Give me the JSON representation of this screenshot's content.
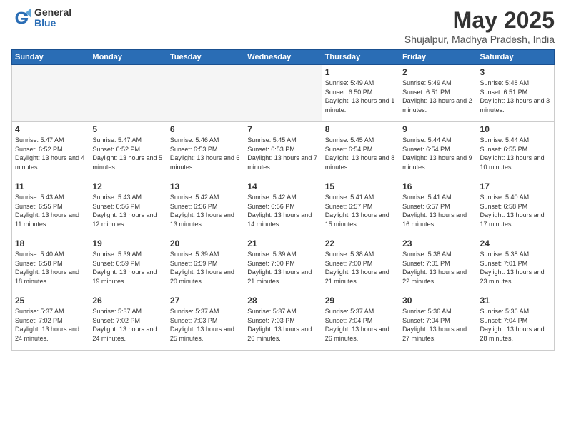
{
  "logo": {
    "general": "General",
    "blue": "Blue"
  },
  "title": "May 2025",
  "location": "Shujalpur, Madhya Pradesh, India",
  "days_of_week": [
    "Sunday",
    "Monday",
    "Tuesday",
    "Wednesday",
    "Thursday",
    "Friday",
    "Saturday"
  ],
  "weeks": [
    [
      {
        "day": "",
        "info": ""
      },
      {
        "day": "",
        "info": ""
      },
      {
        "day": "",
        "info": ""
      },
      {
        "day": "",
        "info": ""
      },
      {
        "day": "1",
        "info": "Sunrise: 5:49 AM\nSunset: 6:50 PM\nDaylight: 13 hours and 1 minute."
      },
      {
        "day": "2",
        "info": "Sunrise: 5:49 AM\nSunset: 6:51 PM\nDaylight: 13 hours and 2 minutes."
      },
      {
        "day": "3",
        "info": "Sunrise: 5:48 AM\nSunset: 6:51 PM\nDaylight: 13 hours and 3 minutes."
      }
    ],
    [
      {
        "day": "4",
        "info": "Sunrise: 5:47 AM\nSunset: 6:52 PM\nDaylight: 13 hours and 4 minutes."
      },
      {
        "day": "5",
        "info": "Sunrise: 5:47 AM\nSunset: 6:52 PM\nDaylight: 13 hours and 5 minutes."
      },
      {
        "day": "6",
        "info": "Sunrise: 5:46 AM\nSunset: 6:53 PM\nDaylight: 13 hours and 6 minutes."
      },
      {
        "day": "7",
        "info": "Sunrise: 5:45 AM\nSunset: 6:53 PM\nDaylight: 13 hours and 7 minutes."
      },
      {
        "day": "8",
        "info": "Sunrise: 5:45 AM\nSunset: 6:54 PM\nDaylight: 13 hours and 8 minutes."
      },
      {
        "day": "9",
        "info": "Sunrise: 5:44 AM\nSunset: 6:54 PM\nDaylight: 13 hours and 9 minutes."
      },
      {
        "day": "10",
        "info": "Sunrise: 5:44 AM\nSunset: 6:55 PM\nDaylight: 13 hours and 10 minutes."
      }
    ],
    [
      {
        "day": "11",
        "info": "Sunrise: 5:43 AM\nSunset: 6:55 PM\nDaylight: 13 hours and 11 minutes."
      },
      {
        "day": "12",
        "info": "Sunrise: 5:43 AM\nSunset: 6:56 PM\nDaylight: 13 hours and 12 minutes."
      },
      {
        "day": "13",
        "info": "Sunrise: 5:42 AM\nSunset: 6:56 PM\nDaylight: 13 hours and 13 minutes."
      },
      {
        "day": "14",
        "info": "Sunrise: 5:42 AM\nSunset: 6:56 PM\nDaylight: 13 hours and 14 minutes."
      },
      {
        "day": "15",
        "info": "Sunrise: 5:41 AM\nSunset: 6:57 PM\nDaylight: 13 hours and 15 minutes."
      },
      {
        "day": "16",
        "info": "Sunrise: 5:41 AM\nSunset: 6:57 PM\nDaylight: 13 hours and 16 minutes."
      },
      {
        "day": "17",
        "info": "Sunrise: 5:40 AM\nSunset: 6:58 PM\nDaylight: 13 hours and 17 minutes."
      }
    ],
    [
      {
        "day": "18",
        "info": "Sunrise: 5:40 AM\nSunset: 6:58 PM\nDaylight: 13 hours and 18 minutes."
      },
      {
        "day": "19",
        "info": "Sunrise: 5:39 AM\nSunset: 6:59 PM\nDaylight: 13 hours and 19 minutes."
      },
      {
        "day": "20",
        "info": "Sunrise: 5:39 AM\nSunset: 6:59 PM\nDaylight: 13 hours and 20 minutes."
      },
      {
        "day": "21",
        "info": "Sunrise: 5:39 AM\nSunset: 7:00 PM\nDaylight: 13 hours and 21 minutes."
      },
      {
        "day": "22",
        "info": "Sunrise: 5:38 AM\nSunset: 7:00 PM\nDaylight: 13 hours and 21 minutes."
      },
      {
        "day": "23",
        "info": "Sunrise: 5:38 AM\nSunset: 7:01 PM\nDaylight: 13 hours and 22 minutes."
      },
      {
        "day": "24",
        "info": "Sunrise: 5:38 AM\nSunset: 7:01 PM\nDaylight: 13 hours and 23 minutes."
      }
    ],
    [
      {
        "day": "25",
        "info": "Sunrise: 5:37 AM\nSunset: 7:02 PM\nDaylight: 13 hours and 24 minutes."
      },
      {
        "day": "26",
        "info": "Sunrise: 5:37 AM\nSunset: 7:02 PM\nDaylight: 13 hours and 24 minutes."
      },
      {
        "day": "27",
        "info": "Sunrise: 5:37 AM\nSunset: 7:03 PM\nDaylight: 13 hours and 25 minutes."
      },
      {
        "day": "28",
        "info": "Sunrise: 5:37 AM\nSunset: 7:03 PM\nDaylight: 13 hours and 26 minutes."
      },
      {
        "day": "29",
        "info": "Sunrise: 5:37 AM\nSunset: 7:04 PM\nDaylight: 13 hours and 26 minutes."
      },
      {
        "day": "30",
        "info": "Sunrise: 5:36 AM\nSunset: 7:04 PM\nDaylight: 13 hours and 27 minutes."
      },
      {
        "day": "31",
        "info": "Sunrise: 5:36 AM\nSunset: 7:04 PM\nDaylight: 13 hours and 28 minutes."
      }
    ]
  ]
}
